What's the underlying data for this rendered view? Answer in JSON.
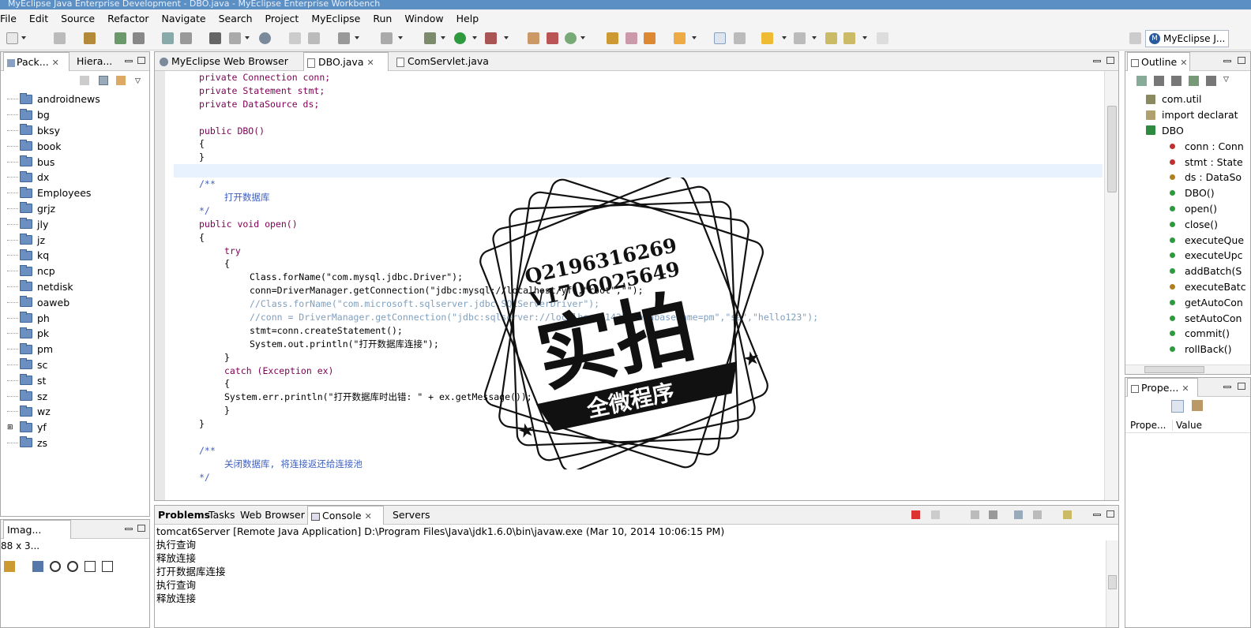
{
  "window_title": "MyEclipse Java Enterprise Development - DBO.java - MyEclipse Enterprise Workbench",
  "menu": [
    "File",
    "Edit",
    "Source",
    "Refactor",
    "Navigate",
    "Search",
    "Project",
    "MyEclipse",
    "Run",
    "Window",
    "Help"
  ],
  "perspective": "MyEclipse J...",
  "left_panel": {
    "tabs": [
      "Pack...",
      "Hiera..."
    ],
    "items": [
      "androidnews",
      "bg",
      "bksy",
      "book",
      "bus",
      "dx",
      "Employees",
      "grjz",
      "jly",
      "jz",
      "kq",
      "ncp",
      "netdisk",
      "oaweb",
      "ph",
      "pk",
      "pm",
      "sc",
      "st",
      "sz",
      "wz",
      "yf",
      "zs"
    ]
  },
  "editor": {
    "tabs": [
      "MyEclipse Web Browser",
      "DBO.java",
      "ComServlet.java"
    ],
    "code": [
      "private Connection conn;",
      "private Statement stmt;",
      "private DataSource ds;",
      "",
      "public DBO()",
      "{",
      "}",
      "",
      "/**",
      "打开数据库",
      "*/",
      "public void open()",
      "{",
      "try",
      "{",
      "Class.forName(\"com.mysql.jdbc.Driver\");",
      "conn=DriverManager.getConnection(\"jdbc:mysql://localhost/yf\",\"root\",\"\");",
      "//Class.forName(\"com.microsoft.sqlserver.jdbc.SQLServerDriver\");",
      "//conn = DriverManager.getConnection(\"jdbc:sqlserver://localhost:1433;DatabaseName=pm\",\"sa\",\"hello123\");",
      "stmt=conn.createStatement();",
      "System.out.println(\"打开数据库连接\");",
      "}",
      "catch (Exception ex)",
      "{",
      "System.err.println(\"打开数据库时出错: \" + ex.getMessage());",
      "}",
      "}",
      "",
      "/**",
      "关闭数据库, 将连接返还给连接池",
      "*/"
    ]
  },
  "console": {
    "tabs": [
      "Problems",
      "Tasks",
      "Web Browser",
      "Console",
      "Servers"
    ],
    "header": "tomcat6Server [Remote Java Application] D:\\Program Files\\Java\\jdk1.6.0\\bin\\javaw.exe (Mar 10, 2014 10:06:15 PM)",
    "lines": [
      "执行查询",
      "释放连接",
      "打开数据库连接",
      "执行查询",
      "释放连接"
    ]
  },
  "outline": {
    "tab": "Outline",
    "items": [
      "com.util",
      "import declarat",
      "DBO",
      "conn : Conn",
      "stmt : State",
      "ds : DataSo",
      "DBO()",
      "open()",
      "close()",
      "executeQue",
      "executeUpc",
      "addBatch(S",
      "executeBatc",
      "getAutoCon",
      "setAutoCon",
      "commit()",
      "rollBack()"
    ]
  },
  "properties": {
    "tab": "Prope...",
    "col1": "Prope...",
    "col2": "Value"
  },
  "image_panel": {
    "tab": "Imag...",
    "dims": "88 x 3..."
  },
  "stamp": {
    "line1": "Q2196316269",
    "line2": "V1706025649",
    "big": "实拍",
    "banner": "全微程序"
  },
  "colors": {
    "keyword": "#7f0055",
    "string": "#2a00ff",
    "comment": "#3f5fbf",
    "titlebar": "#5c8fc4"
  }
}
